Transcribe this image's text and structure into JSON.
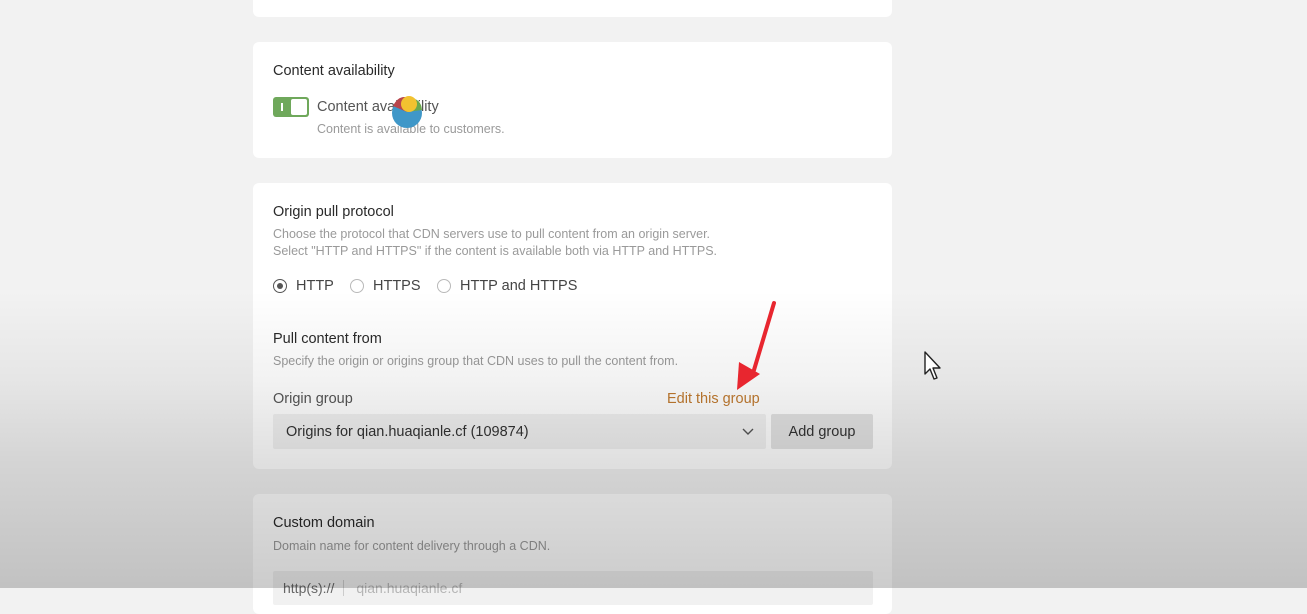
{
  "availability": {
    "title": "Content availability",
    "toggle_label": "Content availability",
    "toggle_desc": "Content is available to customers.",
    "toggle_on": true
  },
  "origin": {
    "title": "Origin pull protocol",
    "desc_line1": "Choose the protocol that CDN servers use to pull content from an origin server.",
    "desc_line2": "Select \"HTTP and HTTPS\" if the content is available both via HTTP and HTTPS.",
    "protocols": [
      {
        "label": "HTTP",
        "checked": true
      },
      {
        "label": "HTTPS",
        "checked": false
      },
      {
        "label": "HTTP and HTTPS",
        "checked": false
      }
    ],
    "pull_title": "Pull content from",
    "pull_desc": "Specify the origin or origins group that CDN uses to pull the content from.",
    "group_label": "Origin group",
    "edit_link": "Edit this group",
    "selected_group": "Origins for qian.huaqianle.cf (109874)",
    "add_group": "Add group"
  },
  "domain": {
    "title": "Custom domain",
    "desc": "Domain name for content delivery through a CDN.",
    "prefix": "http(s)://",
    "placeholder": "qian.huaqianle.cf"
  },
  "colors": {
    "toggle": "#6fa85b",
    "link": "#c07a2f",
    "arrow": "#e8262f"
  },
  "icons": [
    "toggle-switch",
    "radio",
    "chevron-down-icon",
    "annotation-arrow",
    "mouse-cursor-icon"
  ]
}
